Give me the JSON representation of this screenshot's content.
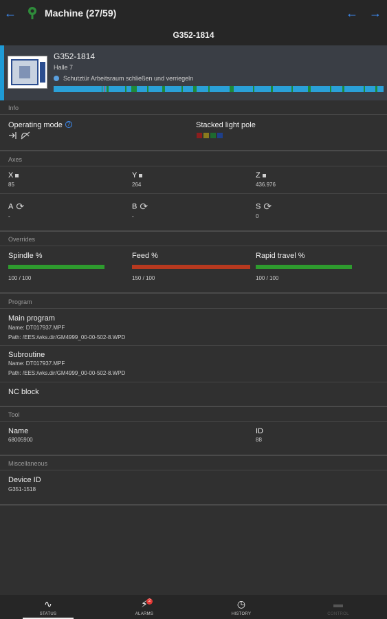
{
  "header": {
    "title": "Machine (27/59)",
    "subtitle": "G352-1814"
  },
  "machine_card": {
    "name": "G352-1814",
    "hall": "Halle 7",
    "message": "Schutztür Arbeitsraum schließen und verriegeln",
    "accent_color": "#1e9bd7"
  },
  "info": {
    "section": "Info",
    "operating_mode_label": "Operating mode",
    "stacked_light_label": "Stacked light pole",
    "lights": [
      "#8b1e1e",
      "#8a7a1e",
      "#1e6a2e",
      "#1e3f8a"
    ]
  },
  "axes": {
    "section": "Axes",
    "x_label": "X",
    "x_value": "85",
    "y_label": "Y",
    "y_value": "264",
    "z_label": "Z",
    "z_value": "436.976",
    "a_label": "A",
    "a_value": "-",
    "b_label": "B",
    "b_value": "-",
    "s_label": "S",
    "s_value": "0"
  },
  "overrides": {
    "section": "Overrides",
    "spindle_label": "Spindle %",
    "spindle_value": "100 / 100",
    "spindle_percent": 100,
    "spindle_color": "#2e9b2e",
    "feed_label": "Feed %",
    "feed_value": "150 / 100",
    "feed_percent": 150,
    "feed_color": "#b7391f",
    "rapid_label": "Rapid travel %",
    "rapid_value": "100 / 100",
    "rapid_percent": 100,
    "rapid_color": "#2e9b2e"
  },
  "program": {
    "section": "Program",
    "main_label": "Main program",
    "main_name": "Name: DT017937.MPF",
    "main_path": "Path: /EES:/wks.dir/GM4999_00-00-502-8.WPD",
    "sub_label": "Subroutine",
    "sub_name": "Name: DT017937.MPF",
    "sub_path": "Path: /EES:/wks.dir/GM4999_00-00-502-8.WPD",
    "nc_label": "NC block"
  },
  "tool": {
    "section": "Tool",
    "name_label": "Name",
    "name_value": "68005900",
    "id_label": "ID",
    "id_value": "88"
  },
  "misc": {
    "section": "Miscellaneous",
    "device_label": "Device ID",
    "device_value": "G351-1518"
  },
  "bottom_nav": {
    "status": "STATUS",
    "alarms": "ALARMS",
    "alarms_badge": "2",
    "history": "HISTORY",
    "control": "CONTROL"
  }
}
